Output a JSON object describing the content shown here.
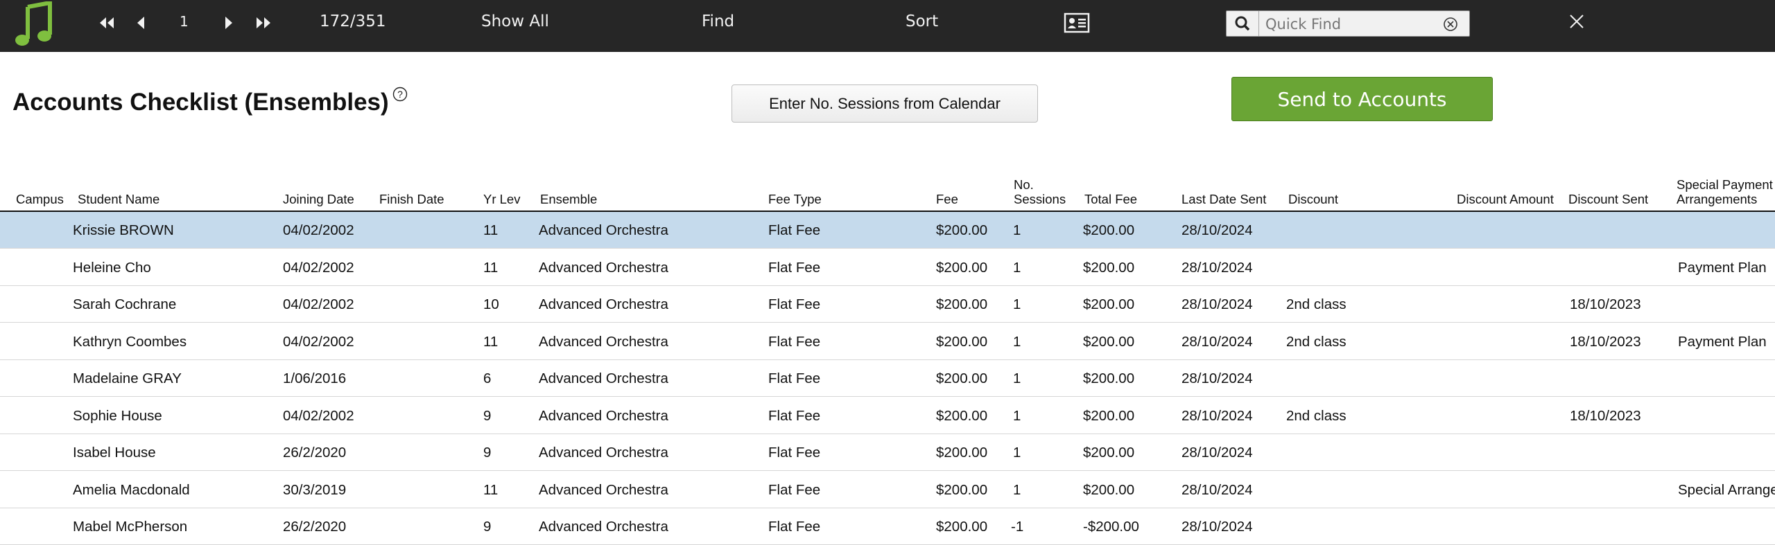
{
  "toolbar": {
    "record_number": "1",
    "record_count": "172/351",
    "show_all": "Show All",
    "find": "Find",
    "sort": "Sort",
    "quick_find_placeholder": "Quick Find",
    "app_icon": "music-note-icon",
    "accent_color": "#7fbf3f"
  },
  "page": {
    "title": "Accounts Checklist (Ensembles)",
    "enter_sessions_label": "Enter No. Sessions from Calendar",
    "send_to_accounts_label": "Send to Accounts",
    "send_button_color": "#6aa535",
    "selected_row_color": "#c5daec"
  },
  "columns": {
    "campus": "Campus",
    "student_name": "Student Name",
    "joining_date": "Joining Date",
    "finish_date": "Finish Date",
    "yr_lev": "Yr Lev",
    "ensemble": "Ensemble",
    "fee_type": "Fee Type",
    "fee": "Fee",
    "sessions_line1": "No.",
    "sessions_line2": "Sessions",
    "total_fee": "Total Fee",
    "last_date_sent": "Last Date Sent",
    "discount": "Discount",
    "discount_amount": "Discount Amount",
    "discount_sent": "Discount Sent",
    "special_line1": "Special Payment",
    "special_line2": "Arrangements"
  },
  "rows": [
    {
      "campus": "",
      "name": "Krissie BROWN",
      "joining": "04/02/2002",
      "finish": "",
      "yr": "11",
      "ensemble": "Advanced Orchestra",
      "fee_type": "Flat Fee",
      "fee": "$200.00",
      "sessions": "1",
      "total": "$200.00",
      "last_sent": "28/10/2024",
      "discount": "",
      "discount_amount": "",
      "discount_sent": "",
      "special": ""
    },
    {
      "campus": "",
      "name": "Heleine Cho",
      "joining": "04/02/2002",
      "finish": "",
      "yr": "11",
      "ensemble": "Advanced Orchestra",
      "fee_type": "Flat Fee",
      "fee": "$200.00",
      "sessions": "1",
      "total": "$200.00",
      "last_sent": "28/10/2024",
      "discount": "",
      "discount_amount": "",
      "discount_sent": "",
      "special": "Payment Plan"
    },
    {
      "campus": "",
      "name": "Sarah Cochrane",
      "joining": "04/02/2002",
      "finish": "",
      "yr": "10",
      "ensemble": "Advanced Orchestra",
      "fee_type": "Flat Fee",
      "fee": "$200.00",
      "sessions": "1",
      "total": "$200.00",
      "last_sent": "28/10/2024",
      "discount": "2nd class",
      "discount_amount": "",
      "discount_sent": "18/10/2023",
      "special": ""
    },
    {
      "campus": "",
      "name": "Kathryn Coombes",
      "joining": "04/02/2002",
      "finish": "",
      "yr": "11",
      "ensemble": "Advanced Orchestra",
      "fee_type": "Flat Fee",
      "fee": "$200.00",
      "sessions": "1",
      "total": "$200.00",
      "last_sent": "28/10/2024",
      "discount": "2nd class",
      "discount_amount": "",
      "discount_sent": "18/10/2023",
      "special": "Payment Plan"
    },
    {
      "campus": "",
      "name": "Madelaine GRAY",
      "joining": "1/06/2016",
      "finish": "",
      "yr": "6",
      "ensemble": "Advanced Orchestra",
      "fee_type": "Flat Fee",
      "fee": "$200.00",
      "sessions": "1",
      "total": "$200.00",
      "last_sent": "28/10/2024",
      "discount": "",
      "discount_amount": "",
      "discount_sent": "",
      "special": ""
    },
    {
      "campus": "",
      "name": "Sophie House",
      "joining": "04/02/2002",
      "finish": "",
      "yr": "9",
      "ensemble": "Advanced Orchestra",
      "fee_type": "Flat Fee",
      "fee": "$200.00",
      "sessions": "1",
      "total": "$200.00",
      "last_sent": "28/10/2024",
      "discount": "2nd class",
      "discount_amount": "",
      "discount_sent": "18/10/2023",
      "special": ""
    },
    {
      "campus": "",
      "name": "Isabel House",
      "joining": "26/2/2020",
      "finish": "",
      "yr": "9",
      "ensemble": "Advanced Orchestra",
      "fee_type": "Flat Fee",
      "fee": "$200.00",
      "sessions": "1",
      "total": "$200.00",
      "last_sent": "28/10/2024",
      "discount": "",
      "discount_amount": "",
      "discount_sent": "",
      "special": ""
    },
    {
      "campus": "",
      "name": "Amelia Macdonald",
      "joining": "30/3/2019",
      "finish": "",
      "yr": "11",
      "ensemble": "Advanced Orchestra",
      "fee_type": "Flat Fee",
      "fee": "$200.00",
      "sessions": "1",
      "total": "$200.00",
      "last_sent": "28/10/2024",
      "discount": "",
      "discount_amount": "",
      "discount_sent": "",
      "special": "Special Arrange"
    },
    {
      "campus": "",
      "name": "Mabel McPherson",
      "joining": "26/2/2020",
      "finish": "",
      "yr": "9",
      "ensemble": "Advanced Orchestra",
      "fee_type": "Flat Fee",
      "fee": "$200.00",
      "sessions": "-1",
      "total": "-$200.00",
      "last_sent": "28/10/2024",
      "discount": "",
      "discount_amount": "",
      "discount_sent": "",
      "special": ""
    }
  ]
}
